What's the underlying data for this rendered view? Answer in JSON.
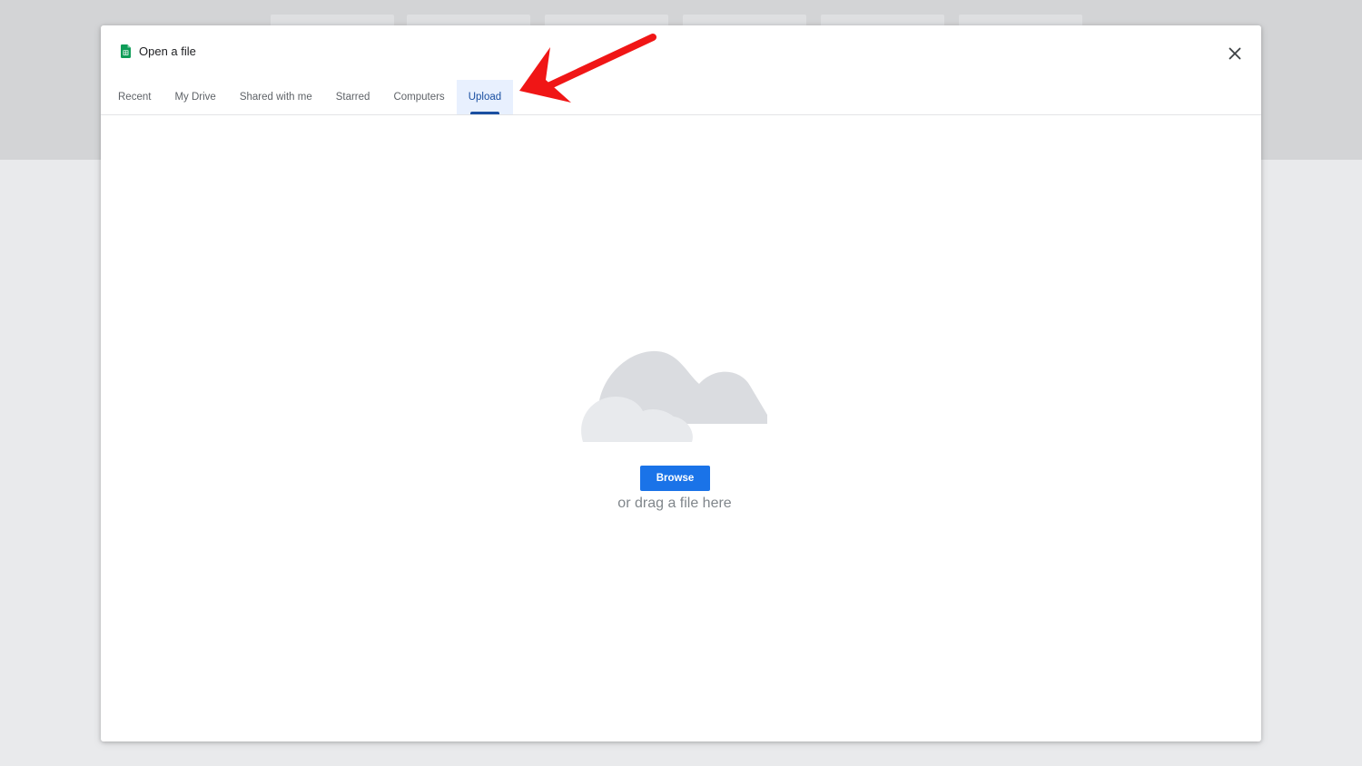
{
  "dialog": {
    "title": "Open a file",
    "icon": "sheets-icon",
    "close_icon": "close-icon"
  },
  "tabs": [
    {
      "label": "Recent",
      "active": false
    },
    {
      "label": "My Drive",
      "active": false
    },
    {
      "label": "Shared with me",
      "active": false
    },
    {
      "label": "Starred",
      "active": false
    },
    {
      "label": "Computers",
      "active": false
    },
    {
      "label": "Upload",
      "active": true
    }
  ],
  "upload": {
    "illustration": "cloud-icon",
    "browse_label": "Browse",
    "drag_hint": "or drag a file here"
  },
  "annotation": {
    "type": "arrow",
    "points_to": "Upload",
    "color": "#f01616"
  },
  "colors": {
    "accent": "#1a73e8",
    "active_tab_text": "#1a4fa1",
    "active_tab_bg": "#e8f0fe",
    "sheets_green": "#0f9d58"
  }
}
